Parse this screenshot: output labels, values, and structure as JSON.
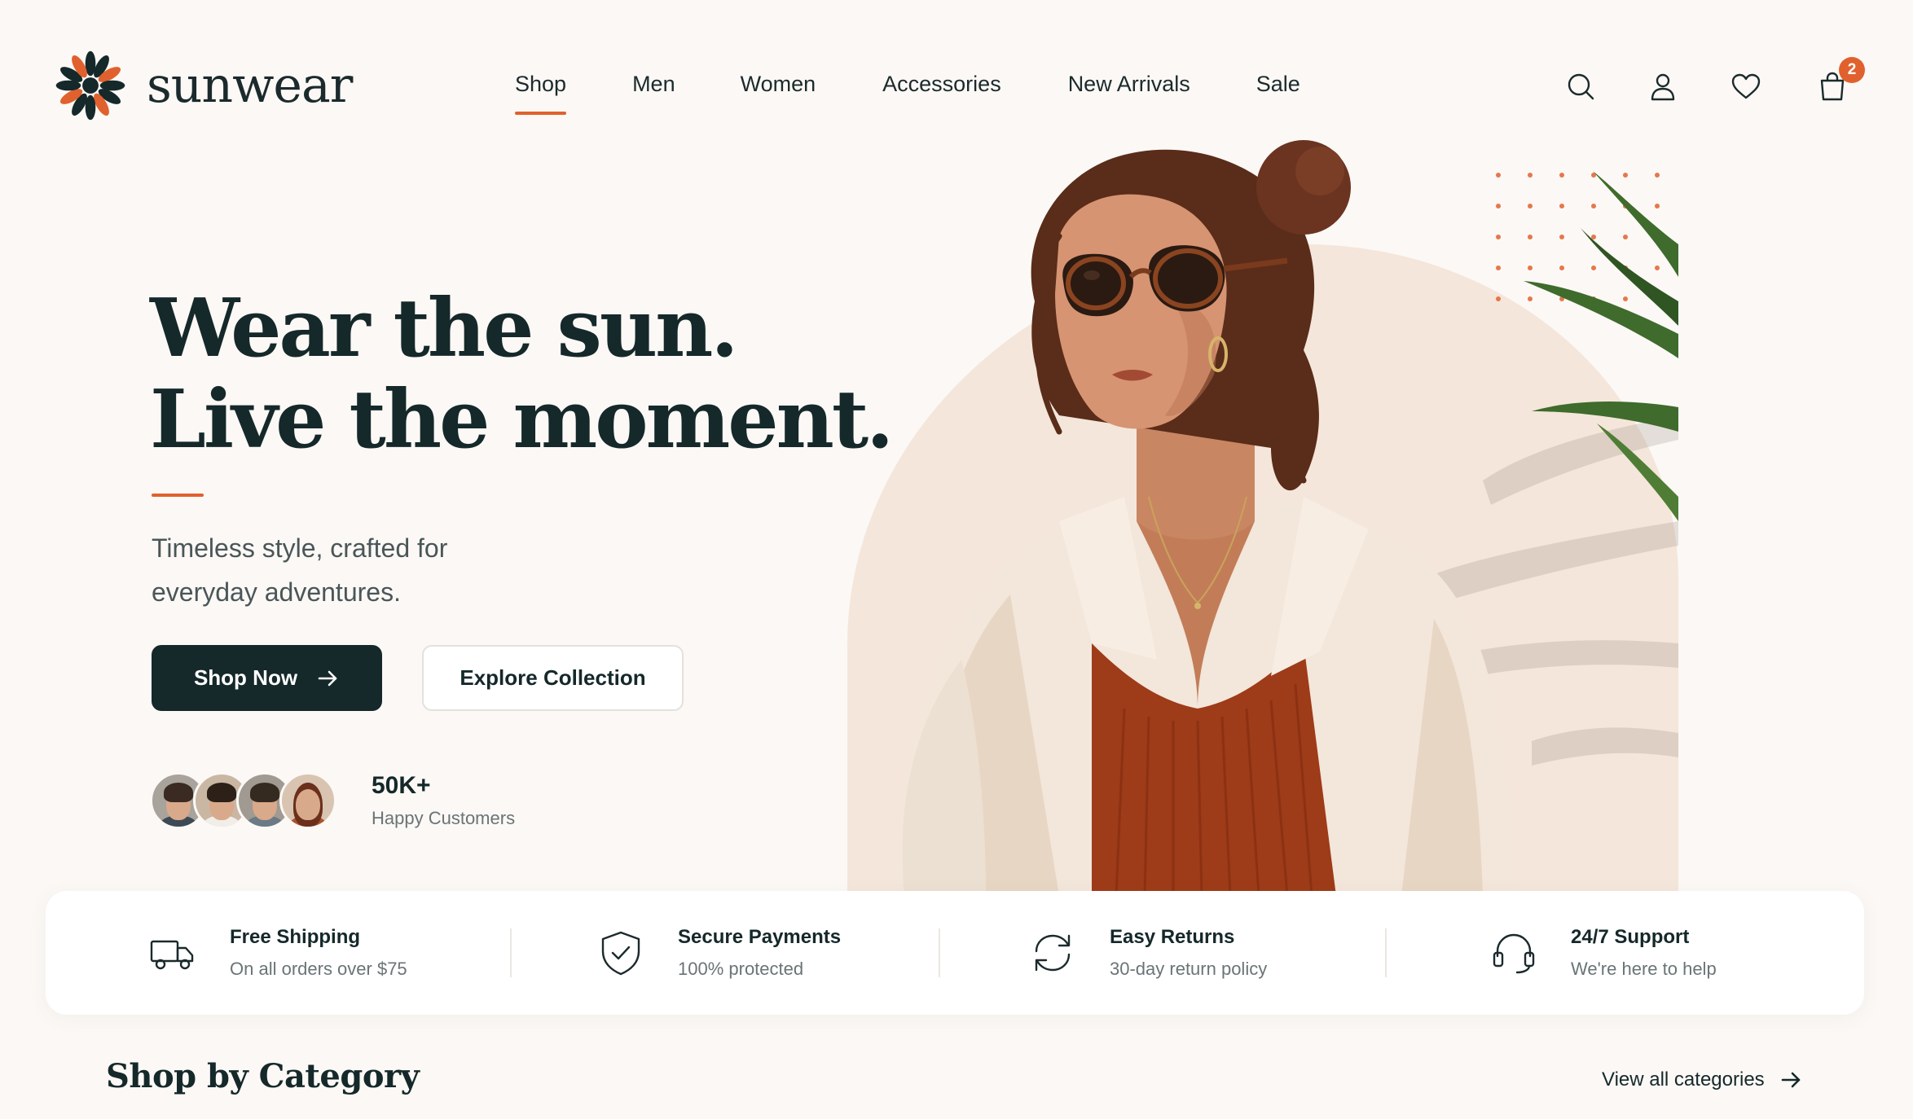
{
  "brand": {
    "name": "sunwear",
    "logo_icon": "sunflower-logo"
  },
  "nav": {
    "items": [
      {
        "label": "Shop",
        "active": true
      },
      {
        "label": "Men",
        "active": false
      },
      {
        "label": "Women",
        "active": false
      },
      {
        "label": "Accessories",
        "active": false
      },
      {
        "label": "New Arrivals",
        "active": false
      },
      {
        "label": "Sale",
        "active": false
      }
    ],
    "icons": [
      "search-icon",
      "user-icon",
      "heart-icon",
      "shopping-bag-icon"
    ],
    "cart_count": "2"
  },
  "hero": {
    "title_line1": "Wear the sun.",
    "title_line2": "Live the moment.",
    "subtitle": "Timeless style, crafted for everyday adventures.",
    "primary_cta": "Shop Now",
    "secondary_cta": "Explore Collection",
    "stat_value": "50K+",
    "stat_label": "Happy Customers"
  },
  "features": [
    {
      "icon": "truck-icon",
      "title": "Free Shipping",
      "subtitle": "On all orders over $75"
    },
    {
      "icon": "shield-check-icon",
      "title": "Secure Payments",
      "subtitle": "100% protected"
    },
    {
      "icon": "refresh-icon",
      "title": "Easy Returns",
      "subtitle": "30-day return policy"
    },
    {
      "icon": "headset-icon",
      "title": "24/7 Support",
      "subtitle": "We're here to help"
    }
  ],
  "category_section": {
    "title": "Shop by Category",
    "view_all": "View all categories"
  },
  "colors": {
    "accent": "#e0612d",
    "dark": "#15282a",
    "background": "#fbf8f5"
  }
}
